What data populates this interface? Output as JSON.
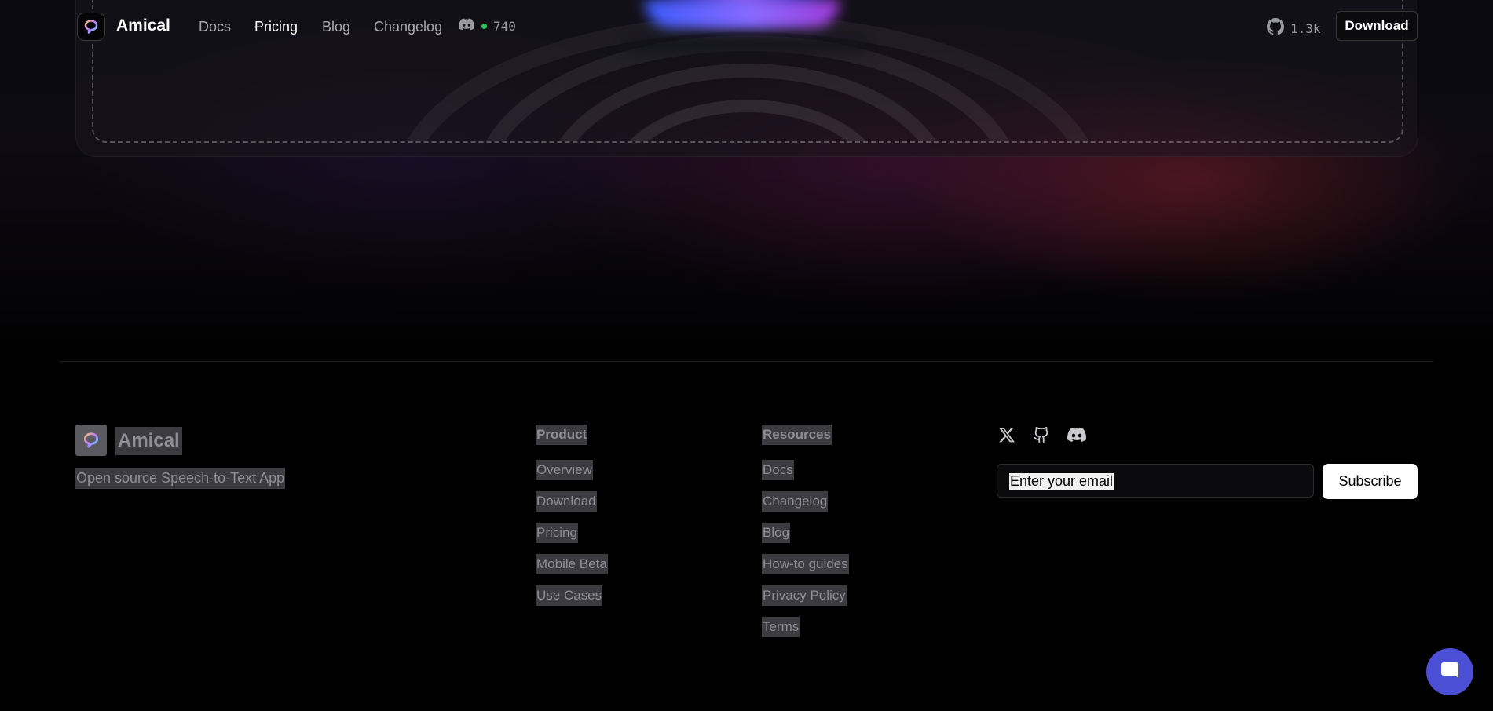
{
  "header": {
    "brand": "Amical",
    "nav": [
      {
        "label": "Docs",
        "active": false
      },
      {
        "label": "Pricing",
        "active": true
      },
      {
        "label": "Blog",
        "active": false
      },
      {
        "label": "Changelog",
        "active": false
      }
    ],
    "discord_online": "740",
    "github_stars": "1.3k",
    "download_label": "Download"
  },
  "footer": {
    "brand": "Amical",
    "tagline": "Open source Speech-to-Text App",
    "product": {
      "heading": "Product",
      "links": [
        "Overview",
        "Download",
        "Pricing",
        "Mobile Beta",
        "Use Cases"
      ]
    },
    "resources": {
      "heading": "Resources",
      "links": [
        "Docs",
        "Changelog",
        "Blog",
        "How-to guides",
        "Privacy Policy",
        "Terms"
      ]
    },
    "social_icons": [
      "x-icon",
      "github-icon",
      "discord-icon"
    ],
    "newsletter": {
      "placeholder": "Enter your email",
      "button_label": "Subscribe"
    }
  },
  "chat_widget_icon": "chat-icon",
  "colors": {
    "background": "#000000",
    "accent_glow_start": "#3a5cff",
    "accent_glow_end": "#a03ad8",
    "online_dot": "#22c55e",
    "chat_bubble": "#4a4fd6"
  }
}
